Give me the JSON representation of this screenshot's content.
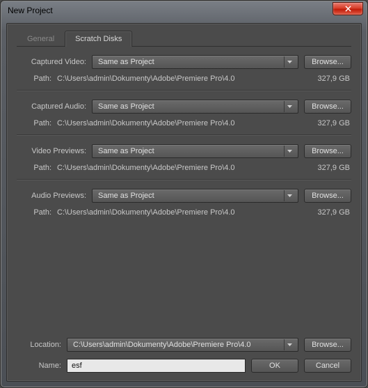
{
  "window": {
    "title": "New Project"
  },
  "tabs": {
    "general": "General",
    "scratch": "Scratch Disks"
  },
  "labels": {
    "captured_video": "Captured Video:",
    "captured_audio": "Captured Audio:",
    "video_previews": "Video Previews:",
    "audio_previews": "Audio Previews:",
    "path": "Path:",
    "location": "Location:",
    "name": "Name:"
  },
  "buttons": {
    "browse": "Browse...",
    "ok": "OK",
    "cancel": "Cancel"
  },
  "dropdown_value": "Same as Project",
  "path_value": "C:\\Users\\admin\\Dokumenty\\Adobe\\Premiere Pro\\4.0",
  "size_value": "327,9 GB",
  "location_value": "C:\\Users\\admin\\Dokumenty\\Adobe\\Premiere Pro\\4.0",
  "name_value": "esf"
}
